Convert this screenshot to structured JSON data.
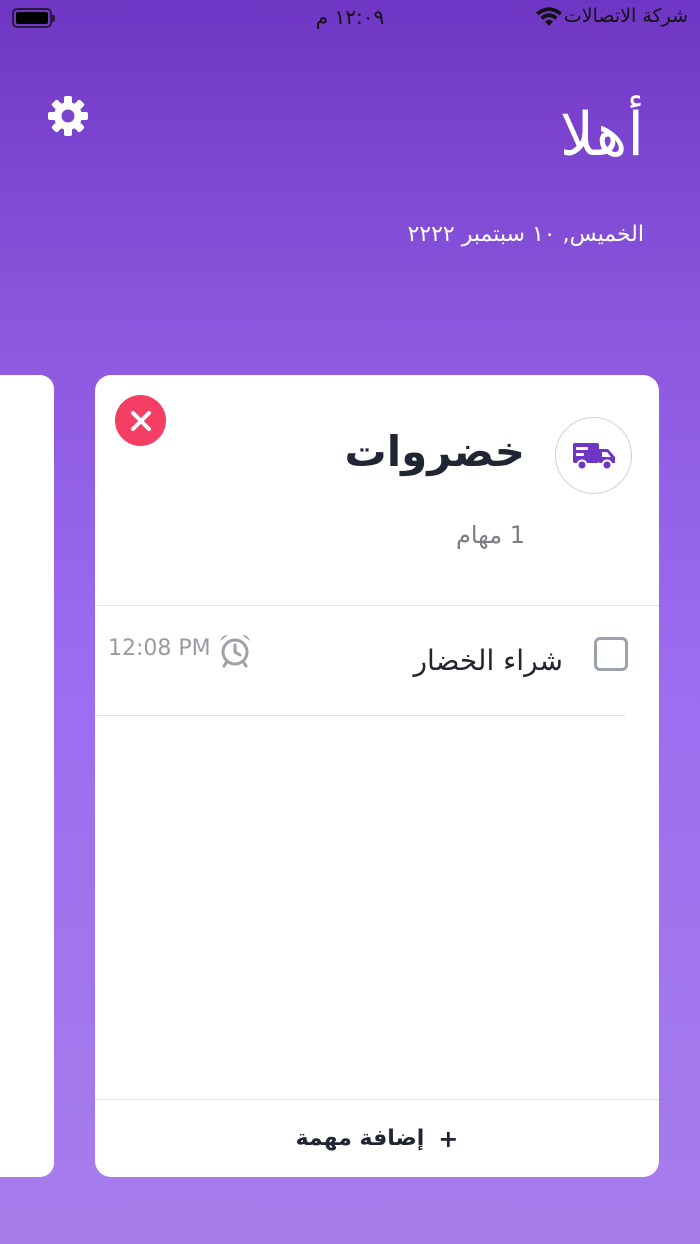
{
  "status_bar": {
    "carrier": "شركة الاتصالات",
    "time": "١٢:٠٩ م"
  },
  "header": {
    "greeting": "أهلا",
    "date": "الخميس, ١٠ سبتمبر ٢٢٢٢"
  },
  "card": {
    "title": "خضروات",
    "icon": "truck-icon",
    "task_count": "1 مهام",
    "tasks": [
      {
        "label": "شراء الخضار",
        "time": "12:08 PM",
        "checked": false
      }
    ],
    "add_task": {
      "plus": "+",
      "label": "إضافة مهمة"
    }
  },
  "colors": {
    "accent": "#6f35c4",
    "close": "#f53e63",
    "title": "#1f2533"
  }
}
